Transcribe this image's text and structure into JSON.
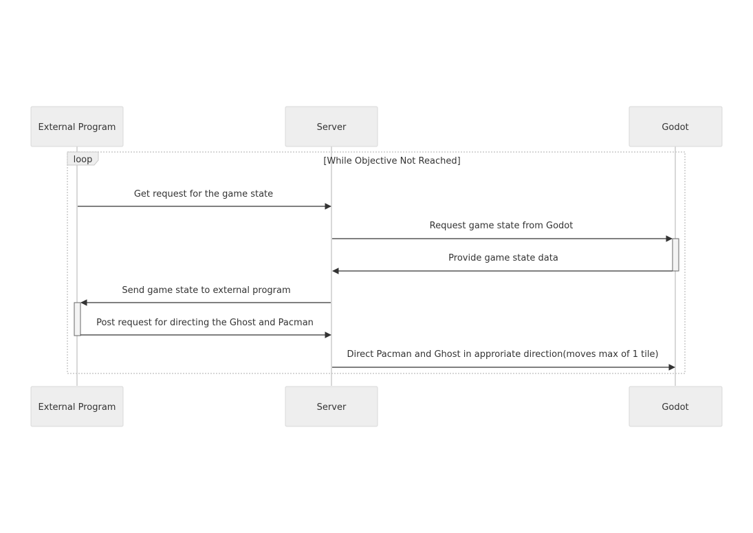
{
  "diagram": {
    "type": "sequence",
    "participants": [
      {
        "id": "ext",
        "label": "External Program"
      },
      {
        "id": "srv",
        "label": "Server"
      },
      {
        "id": "god",
        "label": "Godot"
      }
    ],
    "loop": {
      "keyword": "loop",
      "condition": "[While Objective Not Reached]"
    },
    "messages": [
      {
        "from": "ext",
        "to": "srv",
        "label": "Get request for the game state"
      },
      {
        "from": "srv",
        "to": "god",
        "label": "Request game state from Godot"
      },
      {
        "from": "god",
        "to": "srv",
        "label": "Provide game state data"
      },
      {
        "from": "srv",
        "to": "ext",
        "label": "Send game state to external program"
      },
      {
        "from": "ext",
        "to": "srv",
        "label": "Post request for directing the Ghost and Pacman"
      },
      {
        "from": "srv",
        "to": "god",
        "label": "Direct Pacman and Ghost in approriate direction(moves max of 1 tile)"
      }
    ]
  }
}
